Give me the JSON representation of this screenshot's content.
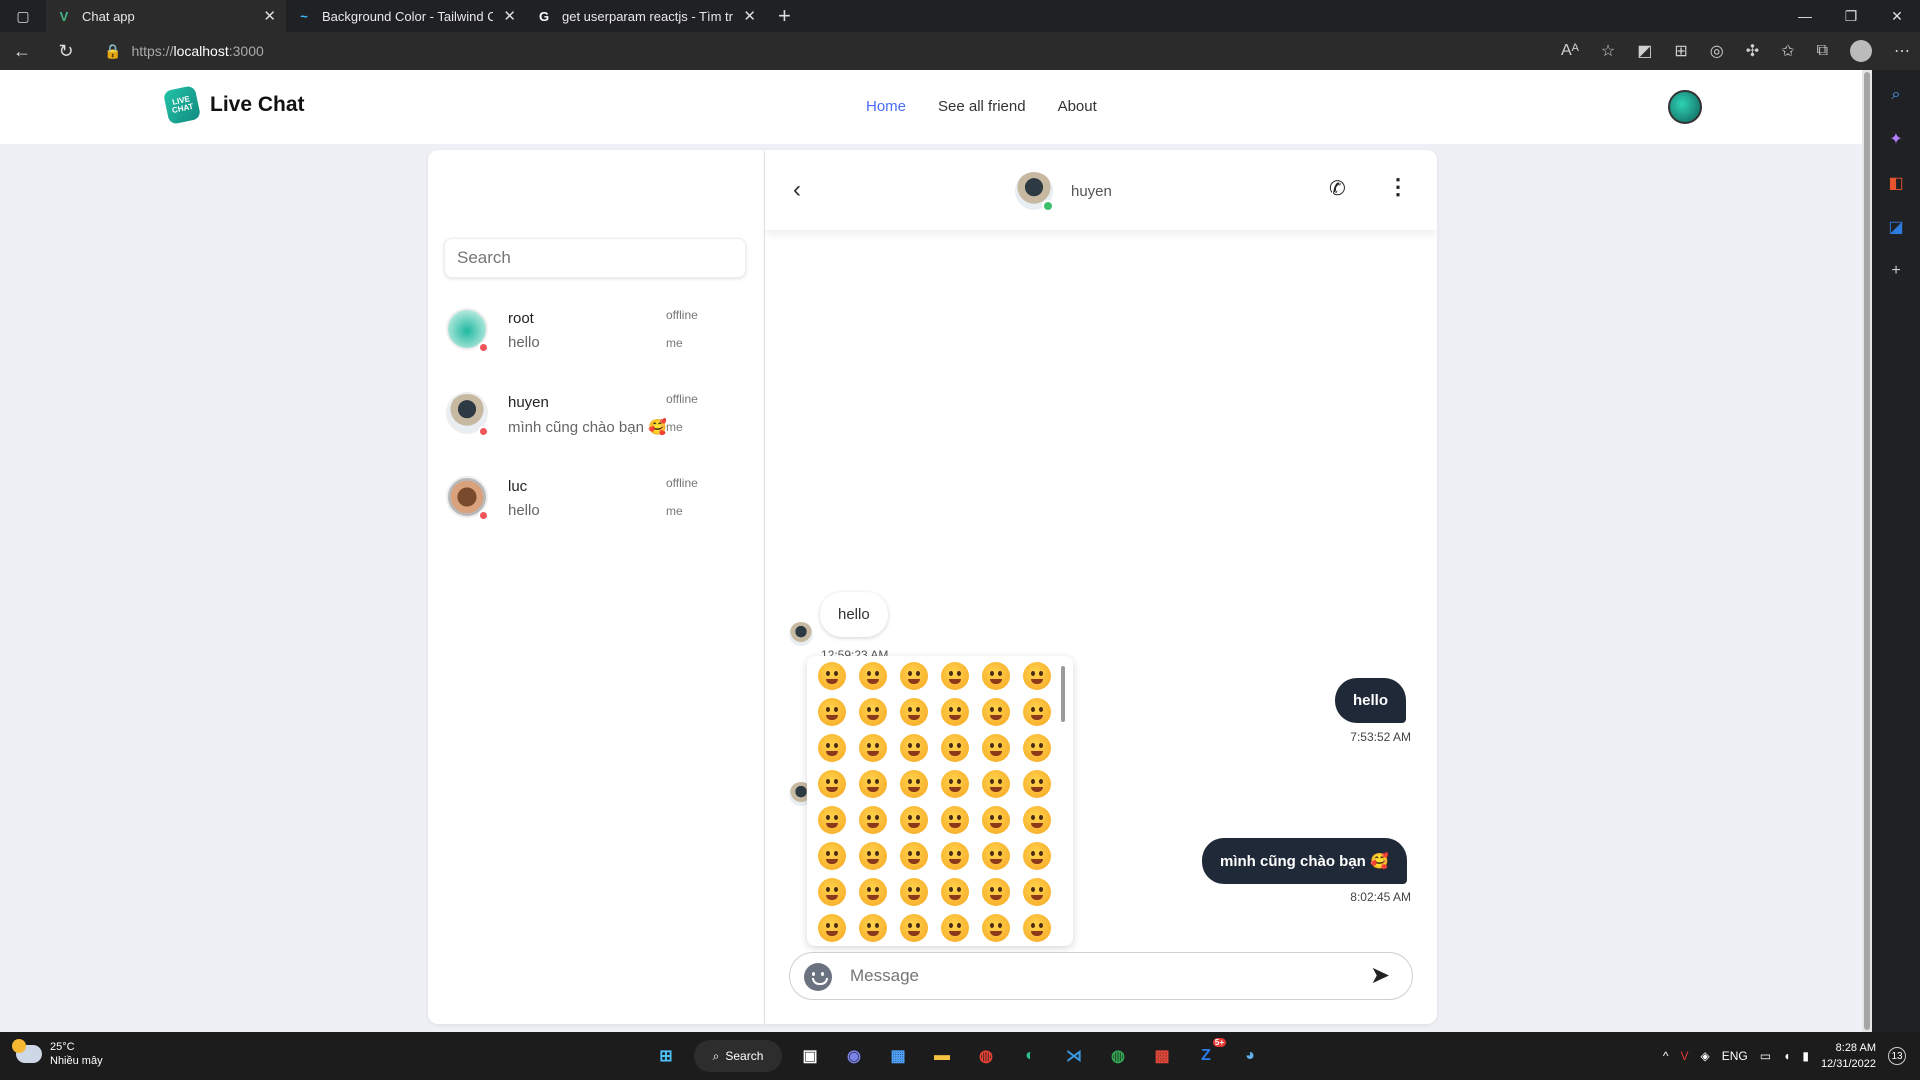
{
  "browser": {
    "tabs": [
      {
        "title": "Chat app",
        "favicon": "vue-icon"
      },
      {
        "title": "Background Color - Tailwind CSS",
        "favicon": "tailwind-icon"
      },
      {
        "title": "get userparam reactjs - Tìm trên",
        "favicon": "google-icon"
      }
    ],
    "url_scheme": "https://",
    "url_host": "localhost",
    "url_port": ":3000"
  },
  "app": {
    "logo_text": "Live Chat",
    "logo_badge": "LIVE CHAT",
    "nav": [
      "Home",
      "See all friend",
      "About"
    ],
    "active_nav": "Home"
  },
  "sidebar": {
    "search_placeholder": "Search",
    "contacts": [
      {
        "name": "root",
        "last_message": "hello",
        "status": "offline",
        "sender": "me"
      },
      {
        "name": "huyen",
        "last_message": "mình cũng chào bạn 🥰",
        "status": "offline",
        "sender": "me"
      },
      {
        "name": "luc",
        "last_message": "hello",
        "status": "offline",
        "sender": "me"
      }
    ]
  },
  "chat": {
    "contact_name": "huyen",
    "online_color": "#3cc06a",
    "offline_color": "#f0555a",
    "messages": [
      {
        "direction": "in",
        "text": "hello",
        "time": "12:59:23 AM"
      },
      {
        "direction": "out",
        "text": "hello",
        "time": "7:53:52 AM"
      },
      {
        "direction": "out",
        "text": "mình cũng chào bạn 🥰",
        "time": "8:02:45 AM"
      }
    ],
    "composer_placeholder": "Message"
  },
  "taskbar": {
    "temperature": "25°C",
    "weather": "Nhiều mây",
    "search_label": "Search",
    "language": "ENG",
    "time": "8:28 AM",
    "date": "12/31/2022",
    "notification_count": "13",
    "zalo_badge": "5+"
  }
}
